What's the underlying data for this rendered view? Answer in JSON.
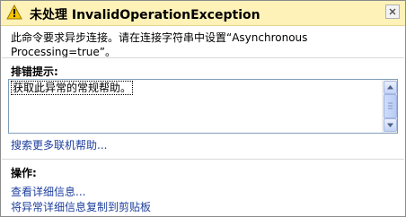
{
  "dialog": {
    "title": "未处理 InvalidOperationException",
    "message": "此命令要求异步连接。请在连接字符串中设置“Asynchronous Processing=true”。",
    "close_icon": "close-icon",
    "warning_icon": "warning-icon"
  },
  "tips": {
    "heading": "排错提示:",
    "items": [
      "获取此异常的常规帮助。"
    ],
    "more_help_link": "搜索更多联机帮助..."
  },
  "actions": {
    "heading": "操作:",
    "links": [
      "查看详细信息...",
      "将异常详细信息复制到剪贴板"
    ]
  },
  "colors": {
    "titlebar_bg": "#fff2b8",
    "link": "#1e3f9e",
    "warning": "#f6c500"
  }
}
